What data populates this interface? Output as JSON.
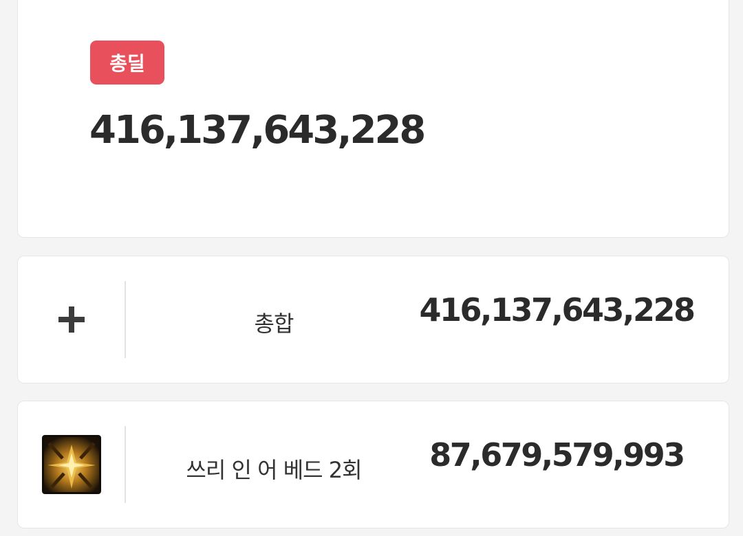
{
  "summary": {
    "badge_label": "총딜",
    "total_damage": "416,137,643,228"
  },
  "rows": [
    {
      "icon": "plus-icon",
      "label": "총합",
      "value": "416,137,643,228"
    },
    {
      "icon": "skill-icon-three-in-bed",
      "label": "쓰리 인 어 베드 2회",
      "value": "87,679,579,993"
    }
  ],
  "colors": {
    "badge_bg": "#e8505b",
    "text": "#2b2b2b",
    "card_bg": "#ffffff",
    "page_bg": "#f4f4f4"
  }
}
